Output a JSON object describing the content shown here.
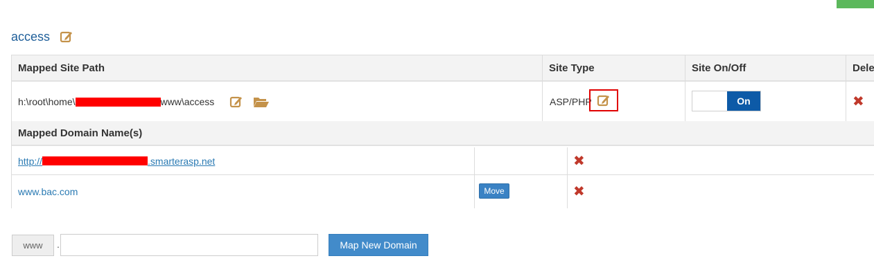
{
  "site": {
    "title": "access"
  },
  "table": {
    "headers": [
      "Mapped Site Path",
      "Site Type",
      "Site On/Off",
      "Dele"
    ],
    "row": {
      "path_prefix": "h:\\root\\home\\",
      "path_suffix": "www\\access",
      "site_type": "ASP/PHP",
      "toggle_label": "On"
    },
    "domains_header": "Mapped Domain Name(s)",
    "domains": [
      {
        "prefix": "http://",
        "suffix": ".smarterasp.net",
        "button": ""
      },
      {
        "prefix": "www.bac.com",
        "suffix": "",
        "button": "Move"
      }
    ]
  },
  "form": {
    "prefix": "www",
    "separator": ".",
    "input_value": "",
    "submit_label": "Map New Domain"
  },
  "colors": {
    "accent": "#1f5f9a",
    "link": "#2a7ab3",
    "toggle_on": "#0d5aa7",
    "delete": "#c0392b",
    "highlight": "#e00000",
    "edit_icon": "#c4924a"
  },
  "icons": [
    "edit-icon",
    "folder-icon",
    "delete-icon"
  ]
}
